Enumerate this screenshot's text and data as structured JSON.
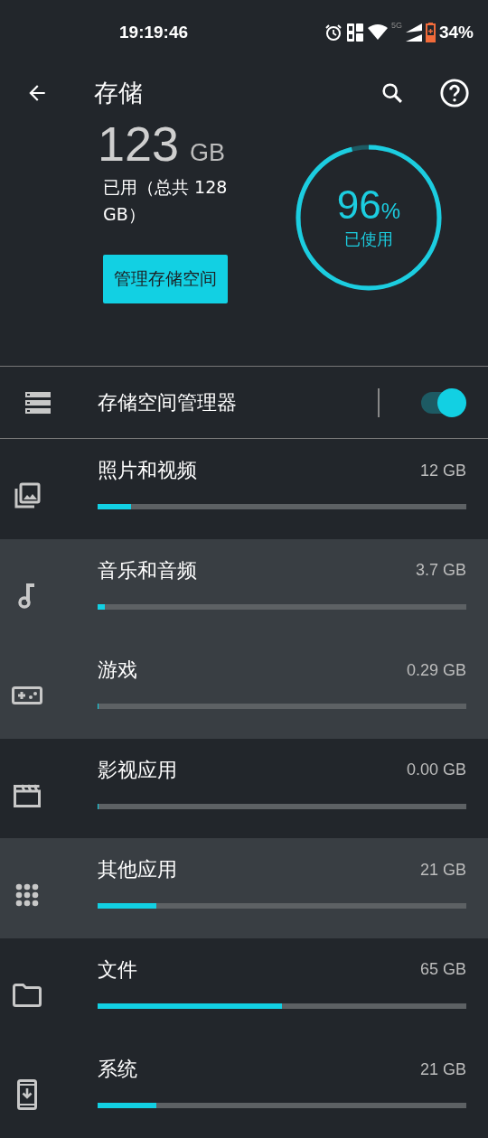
{
  "status_bar": {
    "time": "19:19:46",
    "network": "5G",
    "battery": "34%"
  },
  "toolbar": {
    "title": "存储"
  },
  "summary": {
    "used": "123",
    "unit": "GB",
    "caption": "已用（总共 128 GB）",
    "percent": "96",
    "percent_sign": "%",
    "percent_caption": "已使用",
    "level": 0.96,
    "button": "管理存储空间"
  },
  "manager": {
    "label": "存储空间管理器",
    "on": true
  },
  "categories": [
    {
      "name": "照片和视频",
      "size": "12 GB",
      "level": 0.09,
      "highlighted": false
    },
    {
      "name": "音乐和音频",
      "size": "3.7 GB",
      "level": 0.02,
      "highlighted": true
    },
    {
      "name": "游戏",
      "size": "0.29 GB",
      "level": 0.002,
      "highlighted": true
    },
    {
      "name": "影视应用",
      "size": "0.00 GB",
      "level": 0,
      "highlighted": false
    },
    {
      "name": "其他应用",
      "size": "21 GB",
      "level": 0.16,
      "highlighted": true
    },
    {
      "name": "文件",
      "size": "65 GB",
      "level": 0.5,
      "highlighted": false
    },
    {
      "name": "系统",
      "size": "21 GB",
      "level": 0.16,
      "highlighted": false
    }
  ]
}
